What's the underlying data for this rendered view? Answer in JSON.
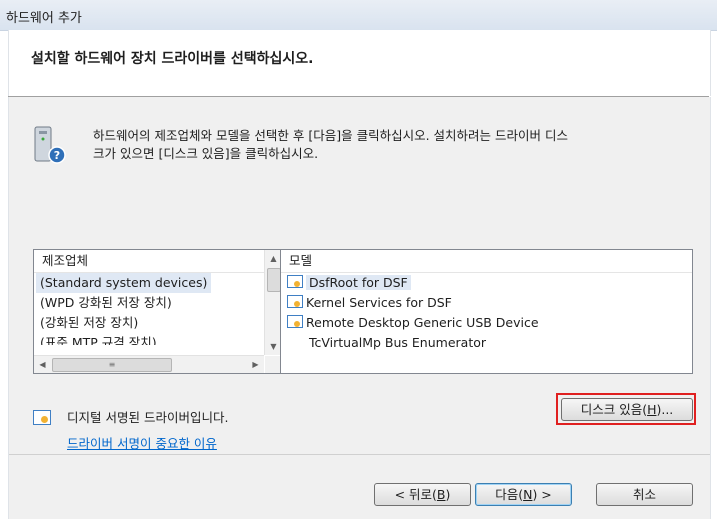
{
  "window": {
    "title": "하드웨어 추가"
  },
  "header": {
    "title": "설치할 하드웨어 장치 드라이버를 선택하십시오."
  },
  "info": {
    "icon": "hardware-help-icon",
    "line1": "하드웨어의 제조업체와 모델을 선택한 후 [다음]을 클릭하십시오. 설치하려는 드라이버 디스",
    "line2": "크가 있으면 [디스크 있음]을 클릭하십시오."
  },
  "manufacturer_list": {
    "header": "제조업체",
    "items": [
      "(Standard system devices)",
      "(WPD 강화된 저장 장치)",
      "(강화된 저장 장치)",
      "(표준 MTP 규격 장치)"
    ],
    "selected": "(Standard system devices)"
  },
  "model_list": {
    "header": "모델",
    "items": [
      {
        "label": "DsfRoot for DSF",
        "signed": true,
        "selected": true
      },
      {
        "label": "Kernel Services for DSF",
        "signed": true
      },
      {
        "label": "Remote Desktop Generic USB Device",
        "signed": true
      },
      {
        "label": "TcVirtualMp Bus Enumerator",
        "signed": false
      }
    ]
  },
  "signature": {
    "icon": "signed-driver-icon",
    "text": "디지털 서명된 드라이버입니다.",
    "link": "드라이버 서명이 중요한 이유"
  },
  "buttons": {
    "have_disk_prefix": "디스크 있음(",
    "have_disk_key": "H",
    "have_disk_suffix": ")...",
    "back_prefix": "< 뒤로(",
    "back_key": "B",
    "back_suffix": ")",
    "next_prefix": "다음(",
    "next_key": "N",
    "next_suffix": ") >",
    "cancel": "취소"
  },
  "colors": {
    "highlight_box": "#e02020",
    "link": "#0066cc"
  }
}
